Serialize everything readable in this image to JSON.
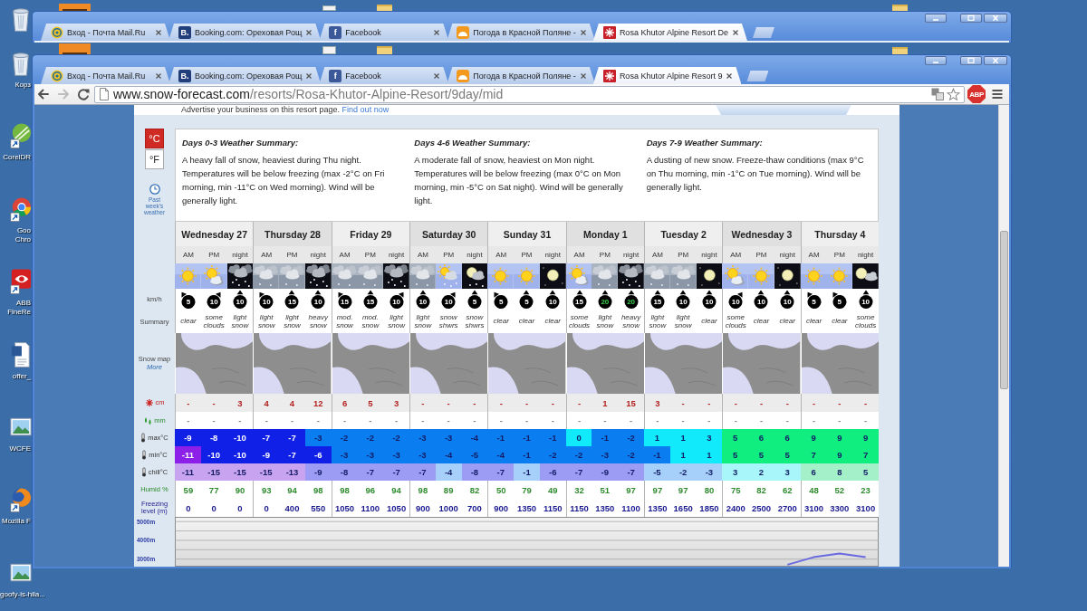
{
  "desktop": {
    "icons": [
      {
        "kind": "trash"
      },
      {
        "kind": "trash",
        "label": [
          "Корз"
        ]
      },
      {
        "kind": "corel",
        "label": [
          "CorelDR"
        ]
      },
      {
        "kind": "chrome",
        "label": [
          "Goo",
          "Chro"
        ]
      },
      {
        "kind": "abbyy",
        "label": [
          "ABB",
          "FineRe"
        ]
      },
      {
        "kind": "word",
        "label": [
          "offer_"
        ]
      },
      {
        "kind": "image",
        "label": [
          "WCFE"
        ]
      },
      {
        "kind": "firefox",
        "label": [
          "Mozilla F"
        ]
      },
      {
        "kind": "image",
        "label": [
          "goofy-is-hila..."
        ]
      }
    ]
  },
  "background_window": {
    "tabs": [
      {
        "title": "Вход - Почта Mail.Ru",
        "kind": "mail",
        "selected": false
      },
      {
        "title": "Booking.com: Ореховая Рощ",
        "kind": "booking",
        "logo": "B.",
        "selected": false
      },
      {
        "title": "Facebook",
        "kind": "facebook",
        "logo": "f",
        "selected": false
      },
      {
        "title": "Погода в Красной Поляне -",
        "kind": "weather",
        "selected": false
      },
      {
        "title": "Rosa Khutor Alpine Resort De",
        "kind": "resort",
        "selected": true
      }
    ]
  },
  "browser": {
    "tabs": [
      {
        "title": "Вход - Почта Mail.Ru",
        "kind": "mail",
        "selected": false
      },
      {
        "title": "Booking.com: Ореховая Рощ",
        "kind": "booking",
        "logo": "B.",
        "selected": false
      },
      {
        "title": "Facebook",
        "kind": "facebook",
        "logo": "f",
        "selected": false
      },
      {
        "title": "Погода в Красной Поляне -",
        "kind": "weather",
        "selected": false
      },
      {
        "title": "Rosa Khutor Alpine Resort 9",
        "kind": "resort",
        "selected": true
      }
    ],
    "toolbar": {
      "back": {
        "disabled": false
      },
      "forward": {
        "disabled": true
      },
      "address": {
        "host": "www.snow-forecast.com",
        "path": "/resorts/Rosa-Khutor-Alpine-Resort/9day/mid"
      },
      "bookmarked": false,
      "adblock": "ABP"
    }
  },
  "page": {
    "advert": {
      "text": "Advertise your business on this resort page.",
      "link": "Find out now"
    },
    "units": [
      {
        "label": "°C",
        "selected": true
      },
      {
        "label": "°F",
        "selected": false
      }
    ],
    "past_weather": "Past week's weather",
    "summaries": [
      {
        "title": "Days 0-3 Weather Summary:",
        "text": "A heavy fall of snow, heaviest during Thu night. Temperatures will be below freezing (max -2°C on Fri morning, min -11°C on Wed morning). Wind will be generally light."
      },
      {
        "title": "Days 4-6 Weather Summary:",
        "text": "A moderate fall of snow, heaviest on Mon night. Temperatures will be below freezing (max 0°C on Mon morning, min -5°C on Sat night). Wind will be generally light."
      },
      {
        "title": "Days 7-9 Weather Summary:",
        "text": "A dusting of new snow. Freeze-thaw conditions (max 9°C on Thu morning, min -1°C on Tue morning). Wind will be generally light."
      }
    ],
    "row_labels": {
      "wind": "km/h",
      "summary": "Summary",
      "snow_map": "Snow map",
      "snow_map_link": "More",
      "snow": "cm",
      "rain": "mm",
      "max": "max°C",
      "min": "min°C",
      "chill": "chill°C",
      "humidity": "Humid %",
      "freezing": "Freezing level (m)"
    },
    "days": [
      {
        "name": "Wednesday 27",
        "periods": [
          {
            "label": "AM",
            "kind": "sun",
            "wind": {
              "speed": "5",
              "kind": "northwest",
              "strong": false
            },
            "summary": "clear",
            "snow": "-",
            "rain": "-",
            "max": {
              "value": "-9",
              "color": "#1020e6"
            },
            "min": {
              "value": "-11",
              "color": "#8c20e8"
            },
            "chill": {
              "value": "-11",
              "color": "#c8a4f0"
            },
            "humidity": "59",
            "freezing": "0"
          },
          {
            "label": "PM",
            "kind": "suncloud",
            "wind": {
              "speed": "10",
              "kind": "northeast",
              "strong": false
            },
            "summary": "some clouds",
            "snow": "-",
            "rain": "-",
            "max": {
              "value": "-8",
              "color": "#1020e6"
            },
            "min": {
              "value": "-10",
              "color": "#1020e6"
            },
            "chill": {
              "value": "-15",
              "color": "#c8a4f0"
            },
            "humidity": "77",
            "freezing": "0"
          },
          {
            "label": "night",
            "kind": "nightsnow",
            "wind": {
              "speed": "10",
              "kind": "north",
              "strong": false
            },
            "summary": "light snow",
            "snow": "3",
            "rain": "-",
            "max": {
              "value": "-10",
              "color": "#1020e6"
            },
            "min": {
              "value": "-10",
              "color": "#1020e6"
            },
            "chill": {
              "value": "-15",
              "color": "#c8a4f0"
            },
            "humidity": "90",
            "freezing": "0"
          }
        ]
      },
      {
        "name": "Thursday 28",
        "periods": [
          {
            "label": "AM",
            "kind": "cloudsnow",
            "wind": {
              "speed": "10",
              "kind": "northwest",
              "strong": false
            },
            "summary": "light snow",
            "snow": "4",
            "rain": "-",
            "max": {
              "value": "-7",
              "color": "#1020e6"
            },
            "min": {
              "value": "-9",
              "color": "#1020e6"
            },
            "chill": {
              "value": "-15",
              "color": "#c8a4f0"
            },
            "humidity": "93",
            "freezing": "0"
          },
          {
            "label": "PM",
            "kind": "cloudsnow",
            "wind": {
              "speed": "15",
              "kind": "north",
              "strong": false
            },
            "summary": "light snow",
            "snow": "4",
            "rain": "-",
            "max": {
              "value": "-7",
              "color": "#1020e6"
            },
            "min": {
              "value": "-7",
              "color": "#1020e6"
            },
            "chill": {
              "value": "-13",
              "color": "#c8a4f0"
            },
            "humidity": "94",
            "freezing": "400"
          },
          {
            "label": "night",
            "kind": "nightsnow",
            "wind": {
              "speed": "10",
              "kind": "north",
              "strong": false
            },
            "summary": "heavy snow",
            "snow": "12",
            "rain": "-",
            "max": {
              "value": "-3",
              "color": "#0a7ef0"
            },
            "min": {
              "value": "-6",
              "color": "#1020e6"
            },
            "chill": {
              "value": "-9",
              "color": "#9c9cf4"
            },
            "humidity": "98",
            "freezing": "550"
          }
        ]
      },
      {
        "name": "Friday 29",
        "periods": [
          {
            "label": "AM",
            "kind": "cloudsnow",
            "wind": {
              "speed": "15",
              "kind": "northwest",
              "strong": false
            },
            "summary": "mod. snow",
            "snow": "6",
            "rain": "-",
            "max": {
              "value": "-2",
              "color": "#0a7ef0"
            },
            "min": {
              "value": "-3",
              "color": "#0a7ef0"
            },
            "chill": {
              "value": "-8",
              "color": "#9c9cf4"
            },
            "humidity": "98",
            "freezing": "1050"
          },
          {
            "label": "PM",
            "kind": "cloudsnow",
            "wind": {
              "speed": "15",
              "kind": "north",
              "strong": false
            },
            "summary": "mod. snow",
            "snow": "5",
            "rain": "-",
            "max": {
              "value": "-2",
              "color": "#0a7ef0"
            },
            "min": {
              "value": "-3",
              "color": "#0a7ef0"
            },
            "chill": {
              "value": "-7",
              "color": "#9c9cf4"
            },
            "humidity": "96",
            "freezing": "1100"
          },
          {
            "label": "night",
            "kind": "nightsnow",
            "wind": {
              "speed": "10",
              "kind": "northeast",
              "strong": false
            },
            "summary": "light snow",
            "snow": "3",
            "rain": "-",
            "max": {
              "value": "-2",
              "color": "#0a7ef0"
            },
            "min": {
              "value": "-3",
              "color": "#0a7ef0"
            },
            "chill": {
              "value": "-7",
              "color": "#9c9cf4"
            },
            "humidity": "94",
            "freezing": "1050"
          }
        ]
      },
      {
        "name": "Saturday 30",
        "periods": [
          {
            "label": "AM",
            "kind": "cloudsnow",
            "wind": {
              "speed": "10",
              "kind": "north",
              "strong": false
            },
            "summary": "light snow",
            "snow": "-",
            "rain": "-",
            "max": {
              "value": "-3",
              "color": "#0a7ef0"
            },
            "min": {
              "value": "-3",
              "color": "#0a7ef0"
            },
            "chill": {
              "value": "-7",
              "color": "#9c9cf4"
            },
            "humidity": "98",
            "freezing": "900"
          },
          {
            "label": "PM",
            "kind": "sunsnow",
            "wind": {
              "speed": "10",
              "kind": "northeast",
              "strong": false
            },
            "summary": "snow shwrs",
            "snow": "-",
            "rain": "-",
            "max": {
              "value": "-3",
              "color": "#0a7ef0"
            },
            "min": {
              "value": "-4",
              "color": "#0a7ef0"
            },
            "chill": {
              "value": "-4",
              "color": "#a6d0fa"
            },
            "humidity": "89",
            "freezing": "1000"
          },
          {
            "label": "night",
            "kind": "moonsnow",
            "wind": {
              "speed": "5",
              "kind": "north",
              "strong": false
            },
            "summary": "snow shwrs",
            "snow": "-",
            "rain": "-",
            "max": {
              "value": "-4",
              "color": "#0a7ef0"
            },
            "min": {
              "value": "-5",
              "color": "#0a7ef0"
            },
            "chill": {
              "value": "-8",
              "color": "#9c9cf4"
            },
            "humidity": "82",
            "freezing": "700"
          }
        ]
      },
      {
        "name": "Sunday 31",
        "periods": [
          {
            "label": "AM",
            "kind": "sun",
            "wind": {
              "speed": "5",
              "kind": "northwest",
              "strong": false
            },
            "summary": "clear",
            "snow": "-",
            "rain": "-",
            "max": {
              "value": "-1",
              "color": "#0a7ef0"
            },
            "min": {
              "value": "-4",
              "color": "#0a7ef0"
            },
            "chill": {
              "value": "-7",
              "color": "#9c9cf4"
            },
            "humidity": "50",
            "freezing": "900"
          },
          {
            "label": "PM",
            "kind": "sun",
            "wind": {
              "speed": "5",
              "kind": "north",
              "strong": false
            },
            "summary": "clear",
            "snow": "-",
            "rain": "-",
            "max": {
              "value": "-1",
              "color": "#0a7ef0"
            },
            "min": {
              "value": "-1",
              "color": "#0a7ef0"
            },
            "chill": {
              "value": "-1",
              "color": "#a6d0fa"
            },
            "humidity": "79",
            "freezing": "1350"
          },
          {
            "label": "night",
            "kind": "moon",
            "wind": {
              "speed": "10",
              "kind": "north",
              "strong": false
            },
            "summary": "clear",
            "snow": "-",
            "rain": "-",
            "max": {
              "value": "-1",
              "color": "#0a7ef0"
            },
            "min": {
              "value": "-2",
              "color": "#0a7ef0"
            },
            "chill": {
              "value": "-6",
              "color": "#9c9cf4"
            },
            "humidity": "49",
            "freezing": "1150"
          }
        ]
      },
      {
        "name": "Monday 1",
        "periods": [
          {
            "label": "AM",
            "kind": "suncloud",
            "wind": {
              "speed": "15",
              "kind": "north",
              "strong": false
            },
            "summary": "some clouds",
            "snow": "-",
            "rain": "-",
            "max": {
              "value": "0",
              "color": "#10eafa"
            },
            "min": {
              "value": "-2",
              "color": "#0a7ef0"
            },
            "chill": {
              "value": "-7",
              "color": "#9c9cf4"
            },
            "humidity": "32",
            "freezing": "1150"
          },
          {
            "label": "PM",
            "kind": "cloudsnow",
            "wind": {
              "speed": "20",
              "kind": "north",
              "strong": true
            },
            "summary": "light snow",
            "snow": "1",
            "rain": "-",
            "max": {
              "value": "-1",
              "color": "#0a7ef0"
            },
            "min": {
              "value": "-3",
              "color": "#0a7ef0"
            },
            "chill": {
              "value": "-9",
              "color": "#9c9cf4"
            },
            "humidity": "51",
            "freezing": "1350"
          },
          {
            "label": "night",
            "kind": "nightsnow",
            "wind": {
              "speed": "20",
              "kind": "north",
              "strong": true
            },
            "summary": "heavy snow",
            "snow": "15",
            "rain": "-",
            "max": {
              "value": "-2",
              "color": "#0a7ef0"
            },
            "min": {
              "value": "-2",
              "color": "#0a7ef0"
            },
            "chill": {
              "value": "-7",
              "color": "#9c9cf4"
            },
            "humidity": "97",
            "freezing": "1100"
          }
        ]
      },
      {
        "name": "Tuesday 2",
        "periods": [
          {
            "label": "AM",
            "kind": "cloudsnow",
            "wind": {
              "speed": "15",
              "kind": "north",
              "strong": false
            },
            "summary": "light snow",
            "snow": "3",
            "rain": "-",
            "max": {
              "value": "1",
              "color": "#10eafa"
            },
            "min": {
              "value": "-1",
              "color": "#0a7ef0"
            },
            "chill": {
              "value": "-5",
              "color": "#a6d0fa"
            },
            "humidity": "97",
            "freezing": "1350"
          },
          {
            "label": "PM",
            "kind": "cloudsnow",
            "wind": {
              "speed": "10",
              "kind": "north",
              "strong": false
            },
            "summary": "light snow",
            "snow": "-",
            "rain": "-",
            "max": {
              "value": "1",
              "color": "#10eafa"
            },
            "min": {
              "value": "1",
              "color": "#10eafa"
            },
            "chill": {
              "value": "-2",
              "color": "#a6d0fa"
            },
            "humidity": "97",
            "freezing": "1650"
          },
          {
            "label": "night",
            "kind": "moon",
            "wind": {
              "speed": "10",
              "kind": "north",
              "strong": false
            },
            "summary": "clear",
            "snow": "-",
            "rain": "-",
            "max": {
              "value": "3",
              "color": "#10eafa"
            },
            "min": {
              "value": "1",
              "color": "#10eafa"
            },
            "chill": {
              "value": "-3",
              "color": "#a6d0fa"
            },
            "humidity": "80",
            "freezing": "1850"
          }
        ]
      },
      {
        "name": "Wednesday 3",
        "periods": [
          {
            "label": "AM",
            "kind": "suncloud",
            "wind": {
              "speed": "10",
              "kind": "northeast",
              "strong": false
            },
            "summary": "some clouds",
            "snow": "-",
            "rain": "-",
            "max": {
              "value": "5",
              "color": "#10ee80"
            },
            "min": {
              "value": "5",
              "color": "#10ee80"
            },
            "chill": {
              "value": "3",
              "color": "#a8f6fa"
            },
            "humidity": "75",
            "freezing": "2400"
          },
          {
            "label": "PM",
            "kind": "sun",
            "wind": {
              "speed": "10",
              "kind": "north",
              "strong": false
            },
            "summary": "clear",
            "snow": "-",
            "rain": "-",
            "max": {
              "value": "6",
              "color": "#10ee80"
            },
            "min": {
              "value": "5",
              "color": "#10ee80"
            },
            "chill": {
              "value": "2",
              "color": "#a8f6fa"
            },
            "humidity": "82",
            "freezing": "2500"
          },
          {
            "label": "night",
            "kind": "moon",
            "wind": {
              "speed": "10",
              "kind": "north",
              "strong": false
            },
            "summary": "clear",
            "snow": "-",
            "rain": "-",
            "max": {
              "value": "6",
              "color": "#10ee80"
            },
            "min": {
              "value": "5",
              "color": "#10ee80"
            },
            "chill": {
              "value": "3",
              "color": "#a8f6fa"
            },
            "humidity": "62",
            "freezing": "2700"
          }
        ]
      },
      {
        "name": "Thursday 4",
        "periods": [
          {
            "label": "AM",
            "kind": "sun",
            "wind": {
              "speed": "5",
              "kind": "northwest",
              "strong": false
            },
            "summary": "clear",
            "snow": "-",
            "rain": "-",
            "max": {
              "value": "9",
              "color": "#10ee80"
            },
            "min": {
              "value": "7",
              "color": "#10ee80"
            },
            "chill": {
              "value": "6",
              "color": "#a4f0c8"
            },
            "humidity": "48",
            "freezing": "3100"
          },
          {
            "label": "PM",
            "kind": "sun",
            "wind": {
              "speed": "5",
              "kind": "northwest",
              "strong": false
            },
            "summary": "clear",
            "snow": "-",
            "rain": "-",
            "max": {
              "value": "9",
              "color": "#10ee80"
            },
            "min": {
              "value": "9",
              "color": "#10ee80"
            },
            "chill": {
              "value": "8",
              "color": "#a4f0c8"
            },
            "humidity": "52",
            "freezing": "3300"
          },
          {
            "label": "night",
            "kind": "mooncloud",
            "wind": {
              "speed": "10",
              "kind": "north",
              "strong": false
            },
            "summary": "some clouds",
            "snow": "-",
            "rain": "-",
            "max": {
              "value": "9",
              "color": "#10ee80"
            },
            "min": {
              "value": "7",
              "color": "#10ee80"
            },
            "chill": {
              "value": "5",
              "color": "#a4f0c8"
            },
            "humidity": "23",
            "freezing": "3100"
          }
        ]
      }
    ],
    "altitude_chart": {
      "chart_data": {
        "type": "line",
        "ylim": [
          2600,
          5250
        ],
        "yticks": [
          {
            "value": 5000,
            "label": "5000m"
          },
          {
            "value": 4000,
            "label": "4000m"
          },
          {
            "value": 3000,
            "label": "3000m"
          }
        ],
        "grid": true,
        "series": [
          {
            "color": "#6a6ae0",
            "values": [
              null,
              null,
              null,
              null,
              null,
              null,
              null,
              null,
              null,
              null,
              null,
              null,
              null,
              null,
              null,
              null,
              null,
              null,
              null,
              null,
              null,
              null,
              null,
              2700,
              3100,
              3300,
              3100
            ]
          }
        ]
      }
    }
  }
}
